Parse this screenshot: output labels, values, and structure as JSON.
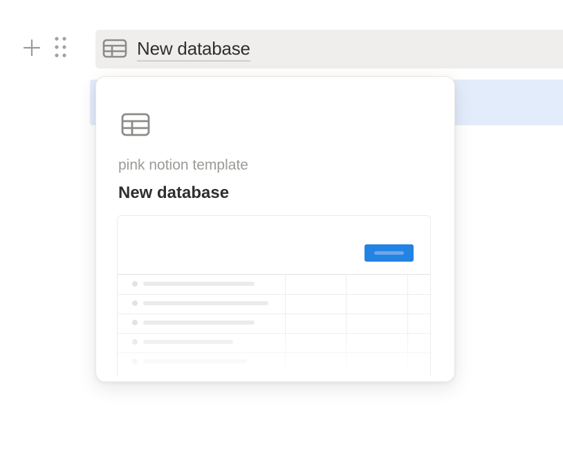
{
  "block": {
    "add_icon": "plus-icon",
    "drag_icon": "drag-handle-icon",
    "database_icon": "table-icon",
    "title": "New database"
  },
  "popup": {
    "icon": "table-icon",
    "breadcrumb": "pink notion template",
    "title": "New database",
    "preview": {
      "button_color": "#2383e2",
      "row_count": 5
    }
  },
  "colors": {
    "selection": "#e3ecfa",
    "bar_background": "#efeeec",
    "accent": "#2383e2"
  }
}
